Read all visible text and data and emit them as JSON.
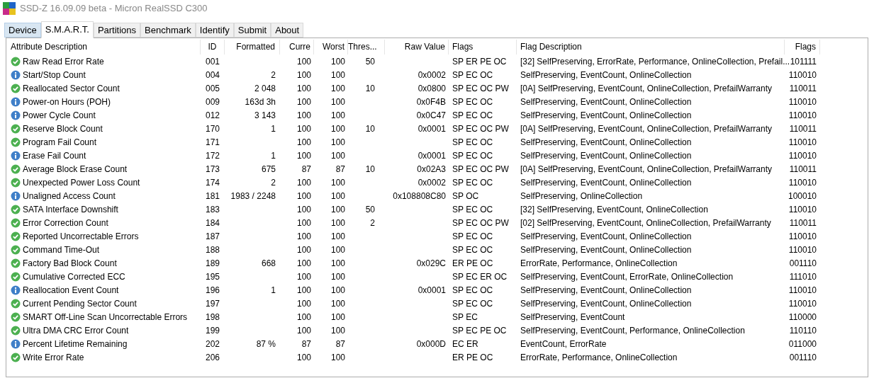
{
  "window": {
    "title": "SSD-Z 16.09.09 beta - Micron RealSSD C300"
  },
  "tabs": [
    {
      "label": "Device",
      "selected": false,
      "highlighted": true
    },
    {
      "label": "S.M.A.R.T.",
      "selected": true,
      "highlighted": false
    },
    {
      "label": "Partitions",
      "selected": false,
      "highlighted": false
    },
    {
      "label": "Benchmark",
      "selected": false,
      "highlighted": false
    },
    {
      "label": "Identify",
      "selected": false,
      "highlighted": false
    },
    {
      "label": "Submit",
      "selected": false,
      "highlighted": false
    },
    {
      "label": "About",
      "selected": false,
      "highlighted": false
    }
  ],
  "table": {
    "columns": [
      "Attribute Description",
      "ID",
      "Formatted",
      "Curre",
      "Worst",
      "Thres...",
      "Raw Value",
      "Flags",
      "Flag Description",
      "Flags"
    ],
    "rows": [
      {
        "kind": "ok",
        "cells": [
          "Raw Read Error Rate",
          "001",
          null,
          "100",
          "100",
          "50",
          null,
          "SP ER PE OC",
          "[32] SelfPreserving, ErrorRate, Performance, OnlineCollection, Prefail...",
          "101111"
        ]
      },
      {
        "kind": "info",
        "cells": [
          "Start/Stop Count",
          "004",
          "2",
          "100",
          "100",
          null,
          "0x0002",
          "SP EC OC",
          "SelfPreserving, EventCount, OnlineCollection",
          "110010"
        ]
      },
      {
        "kind": "ok",
        "cells": [
          "Reallocated Sector Count",
          "005",
          "2 048",
          "100",
          "100",
          "10",
          "0x0800",
          "SP EC OC PW",
          "[0A] SelfPreserving, EventCount, OnlineCollection, PrefailWarranty",
          "110011"
        ]
      },
      {
        "kind": "info",
        "cells": [
          "Power-on Hours (POH)",
          "009",
          "163d 3h",
          "100",
          "100",
          null,
          "0x0F4B",
          "SP EC OC",
          "SelfPreserving, EventCount, OnlineCollection",
          "110010"
        ]
      },
      {
        "kind": "info",
        "cells": [
          "Power Cycle Count",
          "012",
          "3 143",
          "100",
          "100",
          null,
          "0x0C47",
          "SP EC OC",
          "SelfPreserving, EventCount, OnlineCollection",
          "110010"
        ]
      },
      {
        "kind": "ok",
        "cells": [
          "Reserve Block Count",
          "170",
          "1",
          "100",
          "100",
          "10",
          "0x0001",
          "SP EC OC PW",
          "[0A] SelfPreserving, EventCount, OnlineCollection, PrefailWarranty",
          "110011"
        ]
      },
      {
        "kind": "ok",
        "cells": [
          "Program Fail Count",
          "171",
          null,
          "100",
          "100",
          null,
          null,
          "SP EC OC",
          "SelfPreserving, EventCount, OnlineCollection",
          "110010"
        ]
      },
      {
        "kind": "info",
        "cells": [
          "Erase Fail Count",
          "172",
          "1",
          "100",
          "100",
          null,
          "0x0001",
          "SP EC OC",
          "SelfPreserving, EventCount, OnlineCollection",
          "110010"
        ]
      },
      {
        "kind": "ok",
        "cells": [
          "Average Block Erase Count",
          "173",
          "675",
          "87",
          "87",
          "10",
          "0x02A3",
          "SP EC OC PW",
          "[0A] SelfPreserving, EventCount, OnlineCollection, PrefailWarranty",
          "110011"
        ]
      },
      {
        "kind": "ok",
        "cells": [
          "Unexpected Power Loss Count",
          "174",
          "2",
          "100",
          "100",
          null,
          "0x0002",
          "SP EC OC",
          "SelfPreserving, EventCount, OnlineCollection",
          "110010"
        ]
      },
      {
        "kind": "info",
        "cells": [
          "Unaligned Access Count",
          "181",
          "1983 / 2248",
          "100",
          "100",
          null,
          "0x108808C80",
          "SP OC",
          "SelfPreserving, OnlineCollection",
          "100010"
        ]
      },
      {
        "kind": "ok",
        "cells": [
          "SATA Interface Downshift",
          "183",
          null,
          "100",
          "100",
          "50",
          null,
          "SP EC OC",
          "[32] SelfPreserving, EventCount, OnlineCollection",
          "110010"
        ]
      },
      {
        "kind": "ok",
        "cells": [
          "Error Correction Count",
          "184",
          null,
          "100",
          "100",
          "2",
          null,
          "SP EC OC PW",
          "[02] SelfPreserving, EventCount, OnlineCollection, PrefailWarranty",
          "110011"
        ]
      },
      {
        "kind": "ok",
        "cells": [
          "Reported Uncorrectable Errors",
          "187",
          null,
          "100",
          "100",
          null,
          null,
          "SP EC OC",
          "SelfPreserving, EventCount, OnlineCollection",
          "110010"
        ]
      },
      {
        "kind": "ok",
        "cells": [
          "Command Time-Out",
          "188",
          null,
          "100",
          "100",
          null,
          null,
          "SP EC OC",
          "SelfPreserving, EventCount, OnlineCollection",
          "110010"
        ]
      },
      {
        "kind": "ok",
        "cells": [
          "Factory Bad Block Count",
          "189",
          "668",
          "100",
          "100",
          null,
          "0x029C",
          "ER PE OC",
          "ErrorRate, Performance, OnlineCollection",
          "001110"
        ]
      },
      {
        "kind": "ok",
        "cells": [
          "Cumulative Corrected ECC",
          "195",
          null,
          "100",
          "100",
          null,
          null,
          "SP EC ER OC",
          "SelfPreserving, EventCount, ErrorRate, OnlineCollection",
          "111010"
        ]
      },
      {
        "kind": "info",
        "cells": [
          "Reallocation Event Count",
          "196",
          "1",
          "100",
          "100",
          null,
          "0x0001",
          "SP EC OC",
          "SelfPreserving, EventCount, OnlineCollection",
          "110010"
        ]
      },
      {
        "kind": "ok",
        "cells": [
          "Current Pending Sector Count",
          "197",
          null,
          "100",
          "100",
          null,
          null,
          "SP EC OC",
          "SelfPreserving, EventCount, OnlineCollection",
          "110010"
        ]
      },
      {
        "kind": "ok",
        "cells": [
          "SMART Off-Line Scan Uncorrectable Errors",
          "198",
          null,
          "100",
          "100",
          null,
          null,
          "SP EC",
          "SelfPreserving, EventCount",
          "110000"
        ]
      },
      {
        "kind": "ok",
        "cells": [
          "Ultra DMA CRC Error Count",
          "199",
          null,
          "100",
          "100",
          null,
          null,
          "SP EC PE OC",
          "SelfPreserving, EventCount, Performance, OnlineCollection",
          "110110"
        ]
      },
      {
        "kind": "info",
        "cells": [
          "Percent Lifetime Remaining",
          "202",
          "87 %",
          "87",
          "87",
          null,
          "0x000D",
          "EC ER",
          "EventCount, ErrorRate",
          "011000"
        ]
      },
      {
        "kind": "ok",
        "cells": [
          "Write Error Rate",
          "206",
          null,
          "100",
          "100",
          null,
          null,
          "ER PE OC",
          "ErrorRate, Performance, OnlineCollection",
          "001110"
        ]
      }
    ]
  }
}
